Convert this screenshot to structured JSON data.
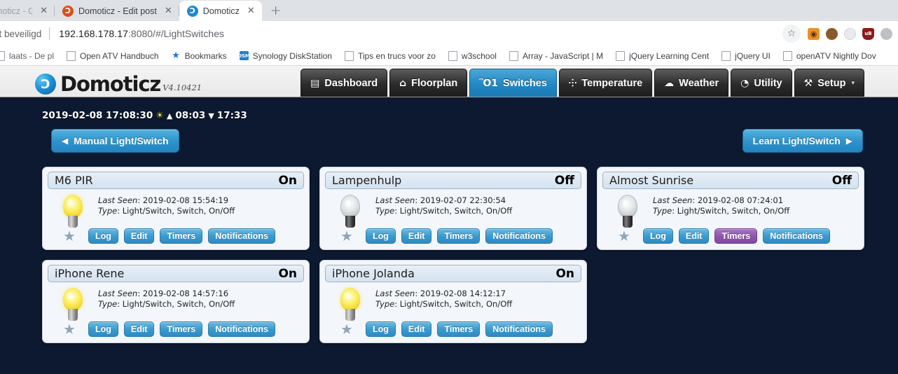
{
  "browser": {
    "tabs": [
      {
        "title": "omoticz - Go",
        "favicon": "none",
        "active": false,
        "truncated": true,
        "dim_tail": true
      },
      {
        "title": "Domoticz - Edit post",
        "favicon": "domoticz-orange",
        "active": false,
        "truncated": false,
        "dim_tail": false
      },
      {
        "title": "Domoticz",
        "favicon": "domoticz-blue",
        "active": true,
        "truncated": false,
        "dim_tail": false
      }
    ],
    "new_tab_label": "+",
    "close_label": "✕",
    "omnibox": {
      "security_label": "iet beveiligd",
      "url_host": "192.168.178.17",
      "url_path": ":8080/#/LightSwitches",
      "bookmark_star": "☆"
    },
    "extensions": [
      {
        "name": "tampermonkey-icon",
        "glyph": "◉"
      },
      {
        "name": "cookie-icon",
        "glyph": ""
      },
      {
        "name": "extension-circle-icon",
        "glyph": ""
      },
      {
        "name": "ublock-origin-icon",
        "glyph": "uB"
      },
      {
        "name": "profile-avatar-icon",
        "glyph": ""
      }
    ],
    "bookmarks": [
      {
        "label": "laats - De pl",
        "icon": "page-icon",
        "truncated": true
      },
      {
        "label": "Open ATV Handbuch",
        "icon": "page-icon",
        "truncated": false
      },
      {
        "label": "Bookmarks",
        "icon": "star-icon",
        "truncated": false
      },
      {
        "label": "Synology DiskStation",
        "icon": "dsm-icon",
        "truncated": false
      },
      {
        "label": "Tips en trucs voor zo",
        "icon": "page-icon",
        "truncated": false
      },
      {
        "label": "w3school",
        "icon": "page-icon",
        "truncated": false
      },
      {
        "label": "Array - JavaScript | M",
        "icon": "page-icon",
        "truncated": false
      },
      {
        "label": "jQuery Learning Cent",
        "icon": "page-icon",
        "truncated": false
      },
      {
        "label": "jQuery UI",
        "icon": "page-icon",
        "truncated": false
      },
      {
        "label": "openATV Nightly Dov",
        "icon": "page-icon",
        "truncated": false
      }
    ]
  },
  "app": {
    "brand_name": "Domoticz",
    "brand_initial": "Ɔ",
    "version": "V4.10421",
    "nav": [
      {
        "label": "Dashboard",
        "icon": "dashboard-icon",
        "glyph": "▤",
        "active": false,
        "caret": false
      },
      {
        "label": "Floorplan",
        "icon": "floorplan-icon",
        "glyph": "⌂",
        "active": false,
        "caret": false
      },
      {
        "label": "Switches",
        "icon": "lightbulb-icon",
        "glyph": "Ὂ1",
        "active": true,
        "caret": false
      },
      {
        "label": "Temperature",
        "icon": "thermometer-icon",
        "glyph": "⸭",
        "active": false,
        "caret": false
      },
      {
        "label": "Weather",
        "icon": "cloud-rain-icon",
        "glyph": "☁",
        "active": false,
        "caret": false
      },
      {
        "label": "Utility",
        "icon": "gauge-icon",
        "glyph": "◔",
        "active": false,
        "caret": false
      },
      {
        "label": "Setup",
        "icon": "tools-icon",
        "glyph": "⚒",
        "active": false,
        "caret": true
      }
    ],
    "nav_caret": "▾",
    "statusline": {
      "datetime": "2019-02-08 17:08:30",
      "sun_icon": "☀",
      "sunrise_arrow": "▲",
      "sunrise": "08:03",
      "sunset_arrow": "▼",
      "sunset": "17:33"
    },
    "actions": {
      "manual": {
        "label": "Manual Light/Switch",
        "arrow": "◀"
      },
      "learn": {
        "label": "Learn Light/Switch",
        "arrow": "▶"
      }
    },
    "labels": {
      "last_seen": "Last Seen",
      "type": "Type",
      "favorite_star": "★"
    },
    "switches": [
      {
        "name": "M6 PIR",
        "state": "On",
        "bulb": "on",
        "last_seen": "2019-02-08 15:54:19",
        "type": "Light/Switch, Switch, On/Off",
        "favorite": false,
        "buttons": [
          {
            "label": "Log",
            "style": "blue"
          },
          {
            "label": "Edit",
            "style": "blue"
          },
          {
            "label": "Timers",
            "style": "blue"
          },
          {
            "label": "Notifications",
            "style": "blue"
          }
        ]
      },
      {
        "name": "Lampenhulp",
        "state": "Off",
        "bulb": "off",
        "last_seen": "2019-02-07 22:30:54",
        "type": "Light/Switch, Switch, On/Off",
        "favorite": false,
        "buttons": [
          {
            "label": "Log",
            "style": "blue"
          },
          {
            "label": "Edit",
            "style": "blue"
          },
          {
            "label": "Timers",
            "style": "blue"
          },
          {
            "label": "Notifications",
            "style": "blue"
          }
        ]
      },
      {
        "name": "Almost Sunrise",
        "state": "Off",
        "bulb": "off",
        "last_seen": "2019-02-08 07:24:01",
        "type": "Light/Switch, Switch, On/Off",
        "favorite": false,
        "buttons": [
          {
            "label": "Log",
            "style": "blue"
          },
          {
            "label": "Edit",
            "style": "blue"
          },
          {
            "label": "Timers",
            "style": "purple"
          },
          {
            "label": "Notifications",
            "style": "blue"
          }
        ]
      },
      {
        "name": "iPhone Rene",
        "state": "On",
        "bulb": "on",
        "last_seen": "2019-02-08 14:57:16",
        "type": "Light/Switch, Switch, On/Off",
        "favorite": false,
        "buttons": [
          {
            "label": "Log",
            "style": "blue"
          },
          {
            "label": "Edit",
            "style": "blue"
          },
          {
            "label": "Timers",
            "style": "blue"
          },
          {
            "label": "Notifications",
            "style": "blue"
          }
        ]
      },
      {
        "name": "iPhone Jolanda",
        "state": "On",
        "bulb": "on",
        "last_seen": "2019-02-08 14:12:17",
        "type": "Light/Switch, Switch, On/Off",
        "favorite": false,
        "buttons": [
          {
            "label": "Log",
            "style": "blue"
          },
          {
            "label": "Edit",
            "style": "blue"
          },
          {
            "label": "Timers",
            "style": "blue"
          },
          {
            "label": "Notifications",
            "style": "blue"
          }
        ]
      }
    ]
  },
  "colors": {
    "page_bg": "#0c1930",
    "accent_blue": "#2f93cc",
    "timer_purple": "#8e55ac",
    "bulb_on": "#f3d933"
  }
}
